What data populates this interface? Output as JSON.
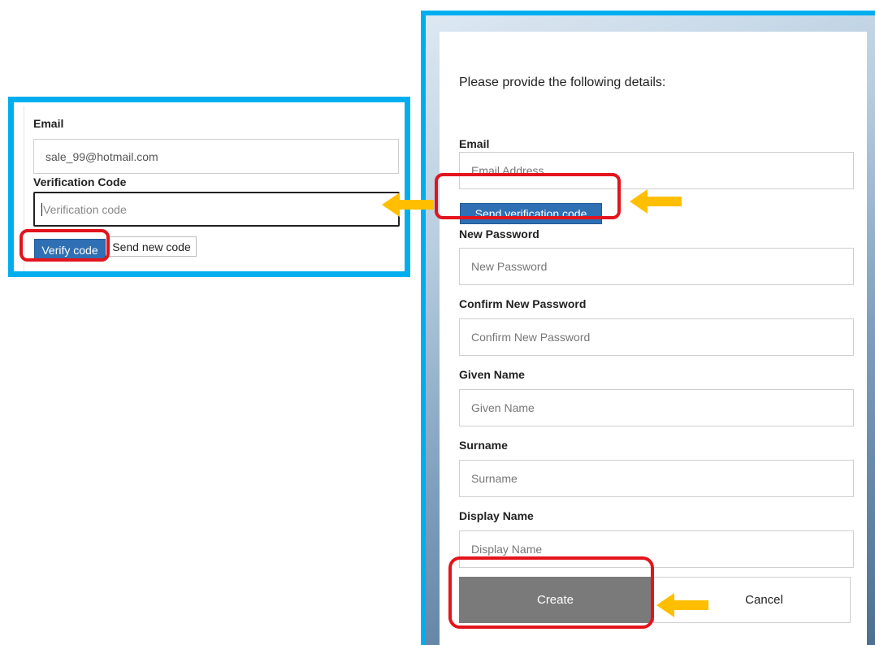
{
  "left_panel": {
    "email_label": "Email",
    "email_value": "sale_99@hotmail.com",
    "verification_label": "Verification Code",
    "verification_placeholder": "Verification code",
    "verify_button": "Verify code",
    "send_new_button": "Send new code"
  },
  "right_panel": {
    "intro": "Please provide the following details:",
    "email_label": "Email",
    "email_placeholder": "Email Address",
    "send_code_button": "Send verification code",
    "new_password_label": "New Password",
    "new_password_placeholder": "New Password",
    "confirm_password_label": "Confirm New Password",
    "confirm_password_placeholder": "Confirm New Password",
    "given_name_label": "Given Name",
    "given_name_placeholder": "Given Name",
    "surname_label": "Surname",
    "surname_placeholder": "Surname",
    "display_name_label": "Display Name",
    "display_name_placeholder": "Display Name",
    "create_button": "Create",
    "cancel_button": "Cancel"
  },
  "colors": {
    "frame": "#00aeef",
    "highlight": "#e3141b",
    "arrow": "#ffbf00",
    "primary_button": "#2f6fb3",
    "create_button": "#7a7a7a"
  }
}
